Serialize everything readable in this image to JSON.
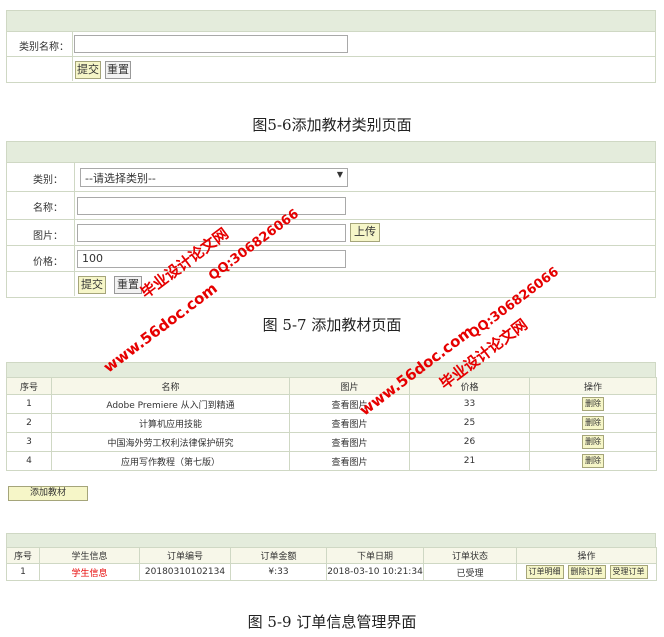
{
  "fig56": {
    "field_label": "类别名称：",
    "submit": "提交",
    "reset": "重置",
    "caption": "图5-6添加教材类别页面"
  },
  "fig57": {
    "category_label": "类别：",
    "category_select": "--请选择类别--",
    "name_label": "名称：",
    "image_label": "图片：",
    "upload": "上传",
    "price_label": "价格：",
    "price_value": "100",
    "submit": "提交",
    "reset": "重置",
    "caption": "图 5-7  添加教材页面"
  },
  "book_table": {
    "headers": [
      "序号",
      "名称",
      "图片",
      "价格",
      "操作"
    ],
    "rows": [
      {
        "no": "1",
        "name": "Adobe Premiere 从入门到精通",
        "img": "查看图片",
        "price": "33",
        "op": "删除"
      },
      {
        "no": "2",
        "name": "计算机应用技能",
        "img": "查看图片",
        "price": "25",
        "op": "删除"
      },
      {
        "no": "3",
        "name": "中国海外劳工权利法律保护研究",
        "img": "查看图片",
        "price": "26",
        "op": "删除"
      },
      {
        "no": "4",
        "name": "应用写作教程（第七版）",
        "img": "查看图片",
        "price": "21",
        "op": "删除"
      }
    ],
    "add_button": "添加教材"
  },
  "order_table": {
    "headers": [
      "序号",
      "学生信息",
      "订单编号",
      "订单金额",
      "下单日期",
      "订单状态",
      "操作"
    ],
    "row": {
      "no": "1",
      "student": "学生信息",
      "order_no": "20180310102134",
      "amount": "¥:33",
      "date": "2018-03-10 10:21:34",
      "status": "已受理",
      "btn_detail": "订单明细",
      "btn_delete": "删除订单",
      "btn_accept": "受理订单"
    },
    "caption": "图 5-9 订单信息管理界面"
  },
  "watermarks": {
    "site": "www.56doc.com",
    "brand": "毕业设计论文网",
    "qq": "QQ:306826066"
  }
}
